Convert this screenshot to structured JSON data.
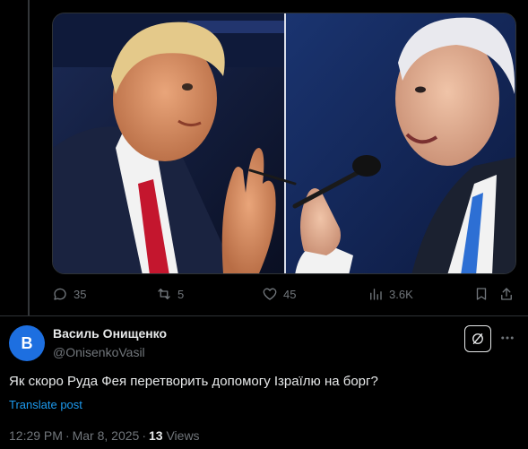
{
  "post": {
    "image_alt": "Split photo of two men speaking at podiums",
    "actions": {
      "replies": "35",
      "reposts": "5",
      "likes": "45",
      "views": "3.6K"
    }
  },
  "reply": {
    "avatar_initial": "B",
    "author_name": "Василь Онищенко",
    "author_handle": "@OnisenkoVasil",
    "text": "Як скоро Руда Фея перетворить допомогу Ізраїлю на борг?",
    "translate_label": "Translate post",
    "time": "12:29 PM",
    "date": "Mar 8, 2025",
    "views_count": "13",
    "views_label": "Views"
  },
  "colors": {
    "background": "#000000",
    "text_primary": "#e7e9ea",
    "text_secondary": "#71767b",
    "link": "#1d9bf0",
    "avatar_bg": "#1d6fe0",
    "border": "#2f3336"
  },
  "icons": {
    "reply": "reply-icon",
    "repost": "repost-icon",
    "like": "heart-icon",
    "views": "analytics-icon",
    "bookmark": "bookmark-icon",
    "share": "share-icon",
    "grok": "grok-icon",
    "more": "more-icon"
  }
}
